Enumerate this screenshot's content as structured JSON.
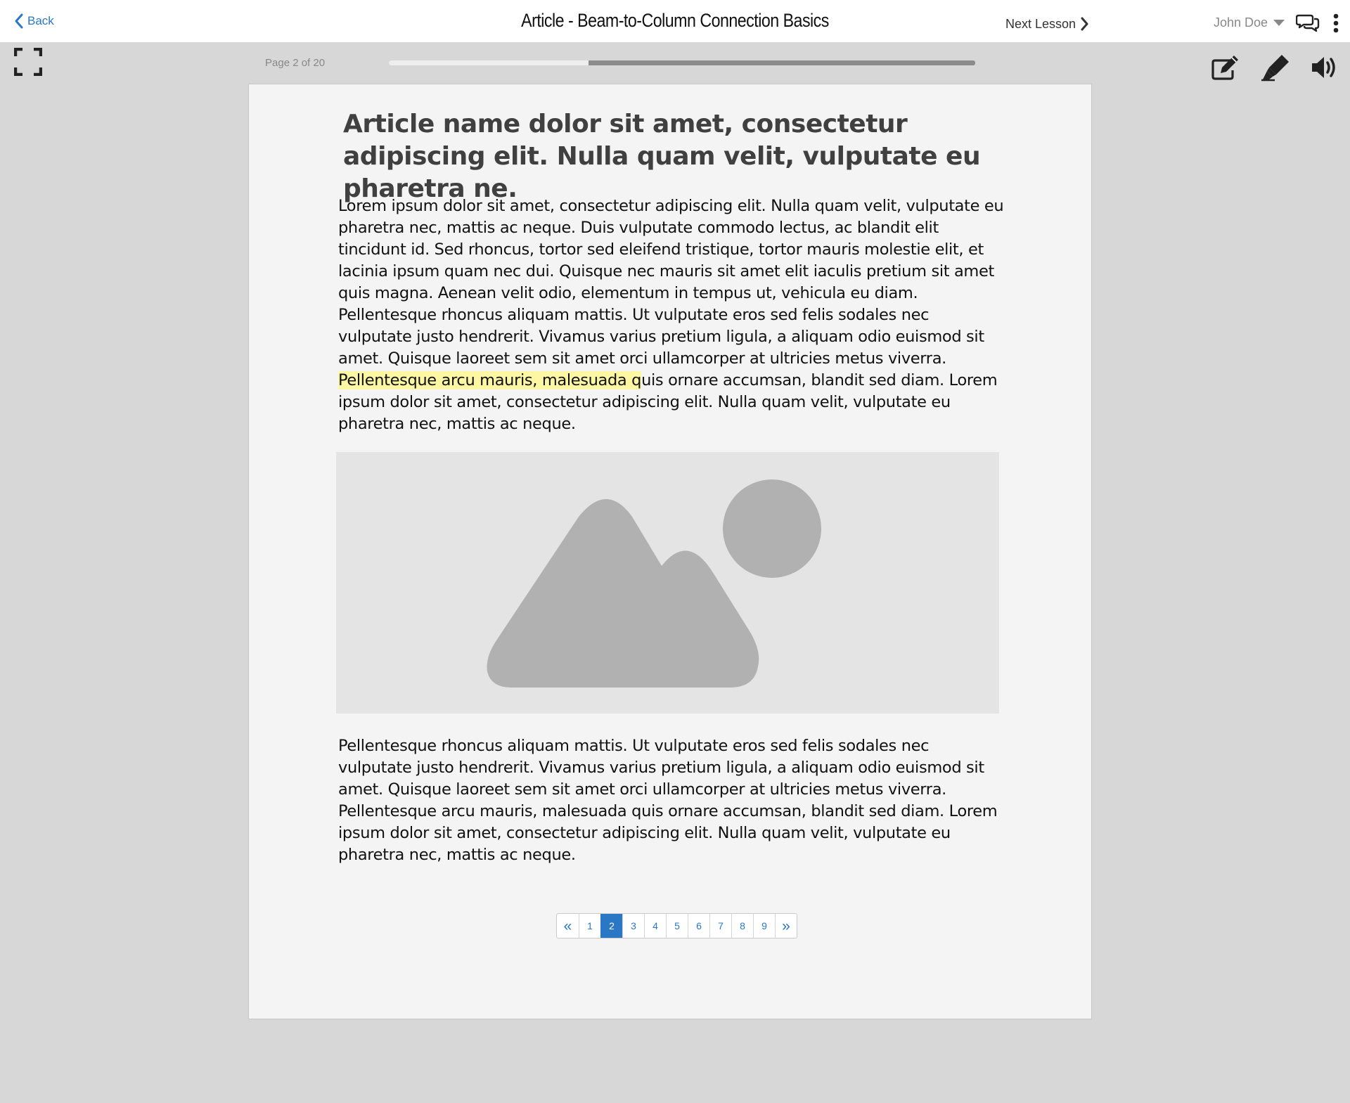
{
  "header": {
    "back_label": "Back",
    "title": "Article - Beam-to-Column Connection Basics",
    "next_label": "Next Lesson",
    "user_name": "John Doe"
  },
  "toolbar": {
    "page_indicator": "Page 2 of 20",
    "progress_fraction": 0.34
  },
  "article": {
    "title": "Article name dolor sit amet, consectetur adipiscing elit. Nulla quam velit, vulputate eu pharetra ne.",
    "p1_before": "Lorem ipsum dolor sit amet, consectetur adipiscing elit. Nulla quam velit, vulputate eu pharetra nec, mattis ac neque. Duis vulputate commodo lectus, ac blandit elit tincidunt id. Sed rhoncus, tortor sed eleifend tristique, tortor mauris molestie elit, et lacinia ipsum quam nec dui. Quisque nec mauris sit amet elit iaculis pretium sit amet quis magna. Aenean velit odio, elementum in tempus ut, vehicula eu diam. Pellentesque rhoncus aliquam mattis. Ut vulputate eros sed felis sodales nec vulputate justo hendrerit. Vivamus varius pretium ligula, a aliquam odio euismod sit amet. Quisque laoreet sem sit amet orci ullamcorper at ultricies metus viverra. ",
    "p1_highlight": "Pellentesque arcu mauris, malesuada q",
    "p1_after": "uis ornare accumsan, blandit sed diam. Lorem ipsum dolor sit amet, consectetur adipiscing elit. Nulla quam velit, vulputate eu pharetra nec, mattis ac neque.",
    "p2": "Pellentesque rhoncus aliquam mattis. Ut vulputate eros sed felis sodales nec vulputate justo hendrerit. Vivamus varius pretium ligula, a aliquam odio euismod sit amet. Quisque laoreet sem sit amet orci ullamcorper at ultricies metus viverra. Pellentesque arcu mauris, malesuada quis ornare accumsan, blandit sed diam. Lorem ipsum dolor sit amet, consectetur adipiscing elit. Nulla quam velit, vulputate eu pharetra nec, mattis ac neque."
  },
  "pagination": {
    "prev": "«",
    "next": "»",
    "pages": [
      "1",
      "2",
      "3",
      "4",
      "5",
      "6",
      "7",
      "8",
      "9"
    ],
    "current": "2"
  },
  "colors": {
    "accent": "#2a78c5",
    "highlight": "#fdf7a4",
    "background": "#d7d7d7",
    "page": "#f4f4f4"
  }
}
